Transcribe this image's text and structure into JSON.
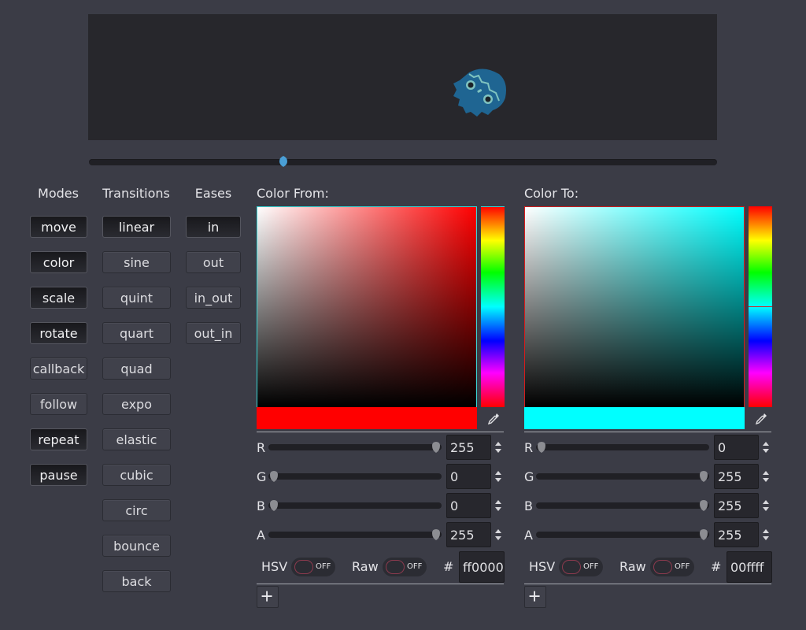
{
  "viewport": {
    "sprite_icon": "godot-robot-logo-icon",
    "sprite_color": "#1f6592"
  },
  "timeline": {
    "progress": 0.31
  },
  "columns": {
    "modes": {
      "title": "Modes",
      "items": [
        {
          "label": "move",
          "pressed": true
        },
        {
          "label": "color",
          "pressed": true
        },
        {
          "label": "scale",
          "pressed": true
        },
        {
          "label": "rotate",
          "pressed": true
        },
        {
          "label": "callback",
          "pressed": false
        },
        {
          "label": "follow",
          "pressed": false
        },
        {
          "label": "repeat",
          "pressed": true
        },
        {
          "label": "pause",
          "pressed": true
        }
      ]
    },
    "transitions": {
      "title": "Transitions",
      "items": [
        {
          "label": "linear",
          "pressed": true
        },
        {
          "label": "sine",
          "pressed": false
        },
        {
          "label": "quint",
          "pressed": false
        },
        {
          "label": "quart",
          "pressed": false
        },
        {
          "label": "quad",
          "pressed": false
        },
        {
          "label": "expo",
          "pressed": false
        },
        {
          "label": "elastic",
          "pressed": false
        },
        {
          "label": "cubic",
          "pressed": false
        },
        {
          "label": "circ",
          "pressed": false
        },
        {
          "label": "bounce",
          "pressed": false
        },
        {
          "label": "back",
          "pressed": false
        }
      ]
    },
    "eases": {
      "title": "Eases",
      "items": [
        {
          "label": "in",
          "pressed": true
        },
        {
          "label": "out",
          "pressed": false
        },
        {
          "label": "in_out",
          "pressed": false
        },
        {
          "label": "out_in",
          "pressed": false
        }
      ]
    }
  },
  "color_from": {
    "label": "Color From:",
    "color": "#ff0000",
    "hue_color": "#ff0000",
    "hue_position": 0.0,
    "border_color": "#39d6d6",
    "channels": [
      {
        "name": "R",
        "value": "255",
        "fraction": 1.0
      },
      {
        "name": "G",
        "value": "0",
        "fraction": 0.0
      },
      {
        "name": "B",
        "value": "0",
        "fraction": 0.0
      },
      {
        "name": "A",
        "value": "255",
        "fraction": 1.0
      }
    ],
    "hsv_label": "HSV",
    "hsv_state": "OFF",
    "raw_label": "Raw",
    "raw_state": "OFF",
    "hash_label": "#",
    "hex": "ff0000",
    "add_label": "+"
  },
  "color_to": {
    "label": "Color To:",
    "color": "#00ffff",
    "hue_color": "#00ffff",
    "hue_position": 0.5,
    "border_color": "#d61c1c",
    "channels": [
      {
        "name": "R",
        "value": "0",
        "fraction": 0.0
      },
      {
        "name": "G",
        "value": "255",
        "fraction": 1.0
      },
      {
        "name": "B",
        "value": "255",
        "fraction": 1.0
      },
      {
        "name": "A",
        "value": "255",
        "fraction": 1.0
      }
    ],
    "hsv_label": "HSV",
    "hsv_state": "OFF",
    "raw_label": "Raw",
    "raw_state": "OFF",
    "hash_label": "#",
    "hex": "00ffff",
    "add_label": "+"
  }
}
